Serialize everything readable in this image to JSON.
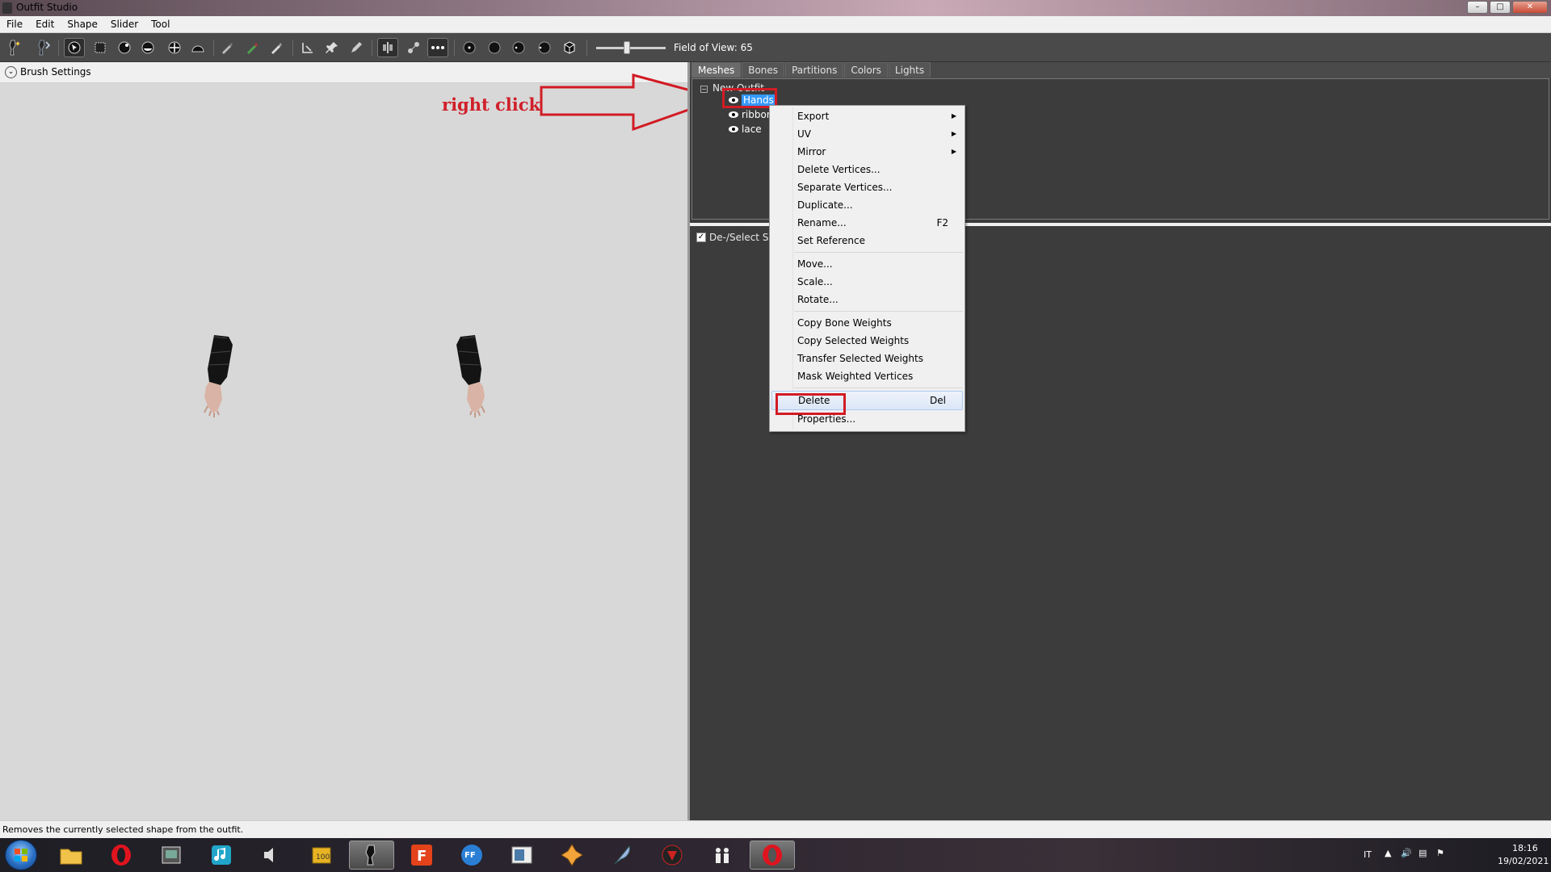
{
  "window": {
    "title": "Outfit Studio",
    "controls": {
      "minimize": "–",
      "maximize": "□",
      "close": "✕"
    }
  },
  "menubar": [
    "File",
    "Edit",
    "Shape",
    "Slider",
    "Tool"
  ],
  "toolbar": {
    "fov_label": "Field of View: 65",
    "fov_value": 65
  },
  "left_panel": {
    "brush_settings_label": "Brush Settings",
    "annotation": "right click"
  },
  "tabs": [
    {
      "label": "Meshes",
      "active": true
    },
    {
      "label": "Bones",
      "active": false
    },
    {
      "label": "Partitions",
      "active": false
    },
    {
      "label": "Colors",
      "active": false
    },
    {
      "label": "Lights",
      "active": false
    }
  ],
  "mesh_tree": {
    "root": "New Outfit",
    "items": [
      {
        "name": "Hands",
        "selected": true
      },
      {
        "name": "ribbon",
        "selected": false
      },
      {
        "name": "lace",
        "selected": false
      }
    ]
  },
  "slider_panel": {
    "header": "De-/Select Slic",
    "checked": true
  },
  "context_menu": {
    "groups": [
      [
        {
          "label": "Export",
          "submenu": true
        },
        {
          "label": "UV",
          "submenu": true
        },
        {
          "label": "Mirror",
          "submenu": true
        },
        {
          "label": "Delete Vertices..."
        },
        {
          "label": "Separate Vertices..."
        },
        {
          "label": "Duplicate..."
        },
        {
          "label": "Rename...",
          "shortcut": "F2"
        },
        {
          "label": "Set Reference"
        }
      ],
      [
        {
          "label": "Move..."
        },
        {
          "label": "Scale..."
        },
        {
          "label": "Rotate..."
        }
      ],
      [
        {
          "label": "Copy Bone Weights"
        },
        {
          "label": "Copy Selected Weights"
        },
        {
          "label": "Transfer Selected Weights"
        },
        {
          "label": "Mask Weighted Vertices"
        }
      ],
      [
        {
          "label": "Delete",
          "shortcut": "Del",
          "highlighted": true
        },
        {
          "label": "Properties..."
        }
      ]
    ]
  },
  "status_bar": "Removes the currently selected shape from the outfit.",
  "taskbar": {
    "apps": [
      "file-explorer",
      "opera",
      "media-center",
      "music-player",
      "audio-app",
      "folder-app",
      "outfit-studio",
      "foxit-reader",
      "ffdec",
      "image-viewer",
      "game-app",
      "feather-app",
      "red-icon-app",
      "people-app",
      "opera-active"
    ],
    "tray": {
      "language": "IT",
      "time": "18:16",
      "date": "19/02/2021"
    }
  },
  "colors": {
    "accent_red": "#d21b24",
    "selection_blue": "#3399ff",
    "panel_dark": "#3c3c3c"
  }
}
